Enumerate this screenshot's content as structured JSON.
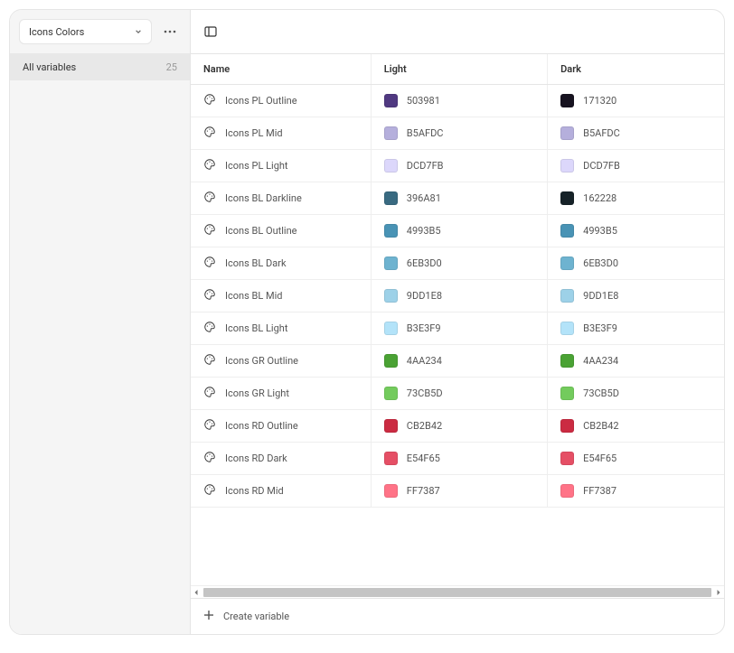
{
  "collection": {
    "name": "Icons Colors"
  },
  "sidebar": {
    "group": {
      "label": "All variables",
      "count": "25"
    }
  },
  "table": {
    "headers": {
      "name": "Name",
      "light": "Light",
      "dark": "Dark"
    }
  },
  "footer": {
    "create_label": "Create variable"
  },
  "variables": [
    {
      "name": "Icons PL Outline",
      "light": {
        "hex": "503981",
        "swatch": "#503981"
      },
      "dark": {
        "hex": "171320",
        "swatch": "#171320"
      }
    },
    {
      "name": "Icons PL Mid",
      "light": {
        "hex": "B5AFDC",
        "swatch": "#B5AFDC"
      },
      "dark": {
        "hex": "B5AFDC",
        "swatch": "#B5AFDC"
      }
    },
    {
      "name": "Icons PL Light",
      "light": {
        "hex": "DCD7FB",
        "swatch": "#DCD7FB"
      },
      "dark": {
        "hex": "DCD7FB",
        "swatch": "#DCD7FB"
      }
    },
    {
      "name": "Icons BL Darkline",
      "light": {
        "hex": "396A81",
        "swatch": "#396A81"
      },
      "dark": {
        "hex": "162228",
        "swatch": "#162228"
      }
    },
    {
      "name": "Icons BL Outline",
      "light": {
        "hex": "4993B5",
        "swatch": "#4993B5"
      },
      "dark": {
        "hex": "4993B5",
        "swatch": "#4993B5"
      }
    },
    {
      "name": "Icons BL Dark",
      "light": {
        "hex": "6EB3D0",
        "swatch": "#6EB3D0"
      },
      "dark": {
        "hex": "6EB3D0",
        "swatch": "#6EB3D0"
      }
    },
    {
      "name": "Icons BL Mid",
      "light": {
        "hex": "9DD1E8",
        "swatch": "#9DD1E8"
      },
      "dark": {
        "hex": "9DD1E8",
        "swatch": "#9DD1E8"
      }
    },
    {
      "name": "Icons BL Light",
      "light": {
        "hex": "B3E3F9",
        "swatch": "#B3E3F9"
      },
      "dark": {
        "hex": "B3E3F9",
        "swatch": "#B3E3F9"
      }
    },
    {
      "name": "Icons GR Outline",
      "light": {
        "hex": "4AA234",
        "swatch": "#4AA234"
      },
      "dark": {
        "hex": "4AA234",
        "swatch": "#4AA234"
      }
    },
    {
      "name": "Icons GR Light",
      "light": {
        "hex": "73CB5D",
        "swatch": "#73CB5D"
      },
      "dark": {
        "hex": "73CB5D",
        "swatch": "#73CB5D"
      }
    },
    {
      "name": "Icons RD Outline",
      "light": {
        "hex": "CB2B42",
        "swatch": "#CB2B42"
      },
      "dark": {
        "hex": "CB2B42",
        "swatch": "#CB2B42"
      }
    },
    {
      "name": "Icons RD Dark",
      "light": {
        "hex": "E54F65",
        "swatch": "#E54F65"
      },
      "dark": {
        "hex": "E54F65",
        "swatch": "#E54F65"
      }
    },
    {
      "name": "Icons RD Mid",
      "light": {
        "hex": "FF7387",
        "swatch": "#FF7387"
      },
      "dark": {
        "hex": "FF7387",
        "swatch": "#FF7387"
      }
    }
  ]
}
